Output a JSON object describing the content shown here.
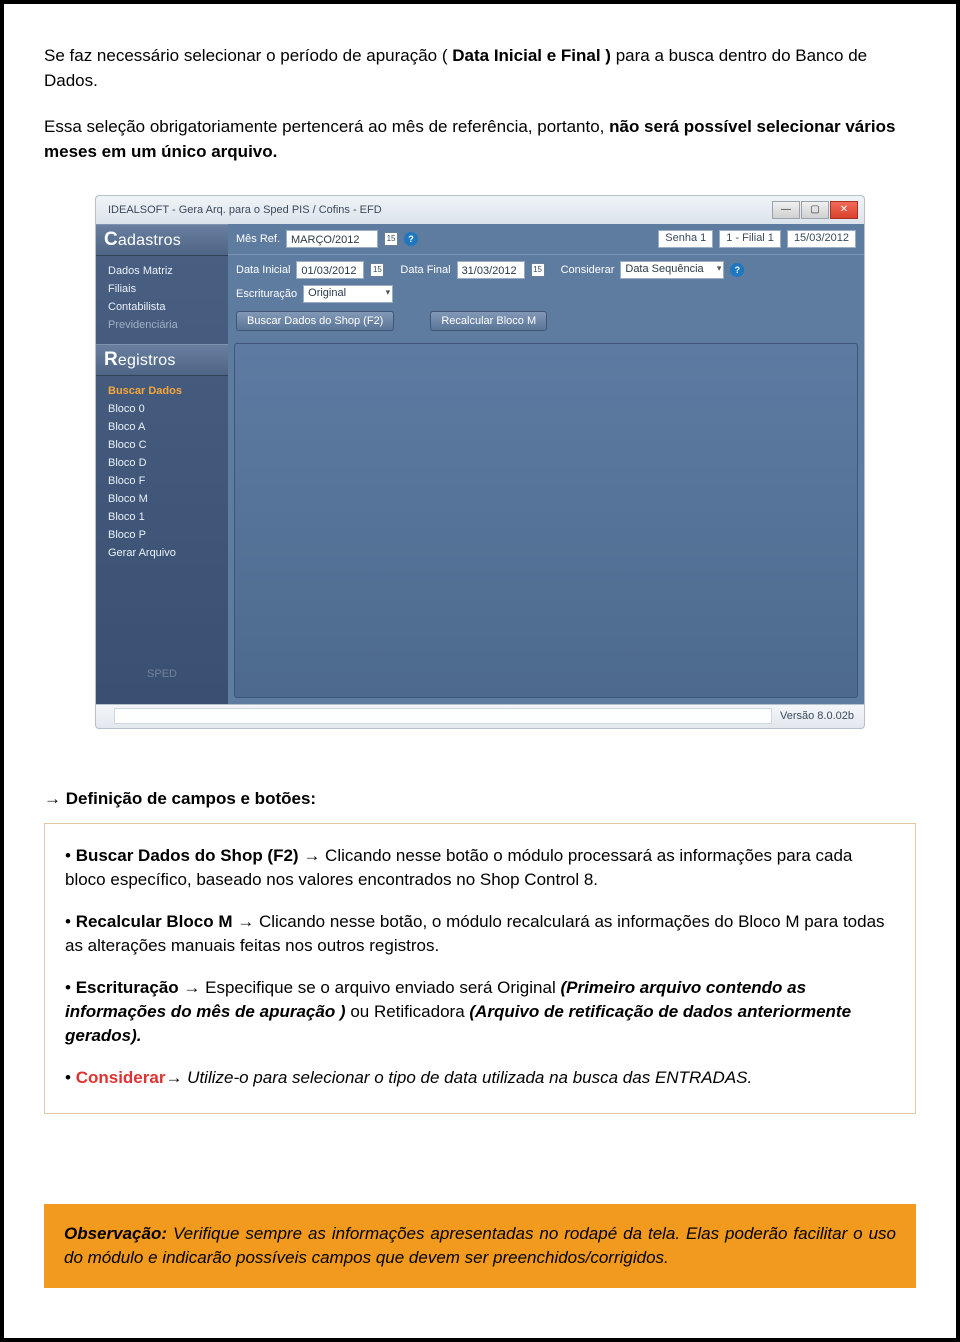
{
  "intro": {
    "line1_pre": "Se faz necessário selecionar o período de apuração ( ",
    "line1_bold": "Data Inicial e Final )",
    "line1_post": " para a busca dentro do Banco de Dados.",
    "line2_pre": "Essa seleção obrigatoriamente pertencerá ao mês de referência, portanto, ",
    "line2_bold": "não será possível selecionar vários meses em um único arquivo."
  },
  "app": {
    "title": "IDEALSOFT - Gera Arq. para o Sped PIS / Cofins - EFD",
    "win_min": "—",
    "win_max": "▢",
    "win_close": "✕",
    "sidebar": {
      "cadastros_head_big": "C",
      "cadastros_head_rest": "adastros",
      "cadastros_items": [
        {
          "label": "Dados Matriz"
        },
        {
          "label": "Filiais"
        },
        {
          "label": "Contabilista"
        },
        {
          "label": "Previdenciária"
        }
      ],
      "registros_head_big": "R",
      "registros_head_rest": "egistros",
      "registros_items": [
        {
          "label": "Buscar Dados"
        },
        {
          "label": "Bloco 0"
        },
        {
          "label": "Bloco A"
        },
        {
          "label": "Bloco C"
        },
        {
          "label": "Bloco D"
        },
        {
          "label": "Bloco F"
        },
        {
          "label": "Bloco M"
        },
        {
          "label": "Bloco 1"
        },
        {
          "label": "Bloco P"
        },
        {
          "label": "Gerar Arquivo"
        }
      ],
      "sped_text": "SPED"
    },
    "header": {
      "mes_label": "Mês Ref.",
      "mes_value": "MARÇO/2012",
      "senha_label": "Senha 1",
      "filial_label": "1 - Filial 1",
      "data_label": "15/03/2012",
      "data_inicial_label": "Data Inicial",
      "data_inicial_value": "01/03/2012",
      "data_final_label": "Data Final",
      "data_final_value": "31/03/2012",
      "considerar_label": "Considerar",
      "considerar_value": "Data Sequência",
      "escrituracao_label": "Escrituração",
      "escrituracao_value": "Original",
      "btn_buscar": "Buscar Dados do Shop (F2)",
      "btn_recalc": "Recalcular Bloco M"
    },
    "status": {
      "version": "Versão 8.0.02b"
    }
  },
  "definitions": {
    "heading_arrow": "→ ",
    "heading": "Definição de campos e botões:",
    "items": [
      {
        "bold": "Buscar Dados do Shop (F2)",
        "text": " → Clicando nesse botão o módulo processará as informações para cada bloco específico, baseado nos valores encontrados no Shop Control 8."
      },
      {
        "bold": "Recalcular Bloco M",
        "text": " → Clicando nesse botão, o módulo recalculará as informações do Bloco M para todas as alterações manuais feitas nos outros registros."
      },
      {
        "bold": "Escrituração",
        "pre": " → Especifique se o arquivo enviado será Original ",
        "italic1": "(Primeiro arquivo contendo as informações do mês de apuração )",
        "mid": " ou Retificadora ",
        "italic2": "(Arquivo de retificação de dados anteriormente gerados)."
      },
      {
        "red": "Considerar",
        "text_italic": "→ Utilize-o para selecionar o tipo de data utilizada na busca das ENTRADAS."
      }
    ]
  },
  "obs": {
    "lead": "Observação:",
    "text": " Verifique sempre as informações apresentadas no rodapé da tela. Elas poderão facilitar o uso do módulo e indicarão possíveis campos que devem ser preenchidos/corrigidos."
  }
}
